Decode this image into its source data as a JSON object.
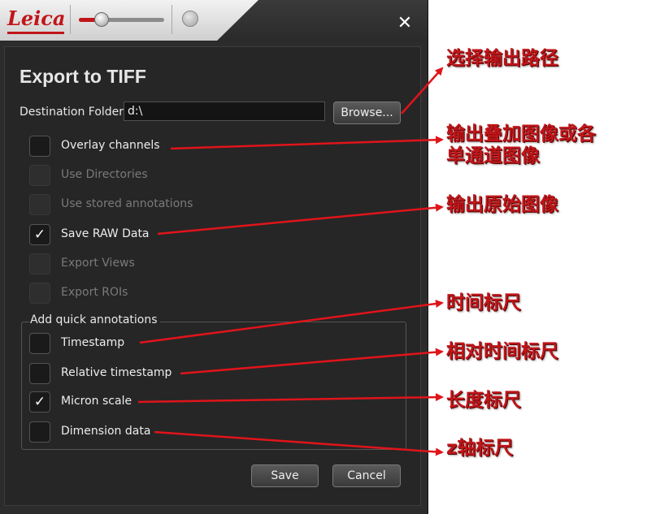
{
  "window": {
    "logo_text": "Leica",
    "close_glyph": "✕",
    "slider_value": 0.25
  },
  "dialog": {
    "title": "Export to TIFF",
    "destination": {
      "label": "Destination Folder",
      "value": "d:\\",
      "browse_label": "Browse..."
    },
    "options": [
      {
        "label": "Overlay channels",
        "checked": false,
        "enabled": true
      },
      {
        "label": "Use Directories",
        "checked": false,
        "enabled": false
      },
      {
        "label": "Use stored annotations",
        "checked": false,
        "enabled": false
      },
      {
        "label": "Save RAW Data",
        "checked": true,
        "enabled": true
      },
      {
        "label": "Export Views",
        "checked": false,
        "enabled": false
      },
      {
        "label": "Export ROIs",
        "checked": false,
        "enabled": false
      }
    ],
    "quick_annotations": {
      "title": "Add quick annotations",
      "items": [
        {
          "label": "Timestamp",
          "checked": false
        },
        {
          "label": "Relative timestamp",
          "checked": false
        },
        {
          "label": "Micron scale",
          "checked": true
        },
        {
          "label": "Dimension data",
          "checked": false
        }
      ]
    },
    "save_label": "Save",
    "cancel_label": "Cancel",
    "check_glyph": "✓"
  },
  "annotations": {
    "color": "#c0161a",
    "items": [
      "选择输出路径",
      "输出叠加图像或各",
      "单通道图像",
      "输出原始图像",
      "时间标尺",
      "相对时间标尺",
      "长度标尺",
      "z轴标尺"
    ]
  }
}
